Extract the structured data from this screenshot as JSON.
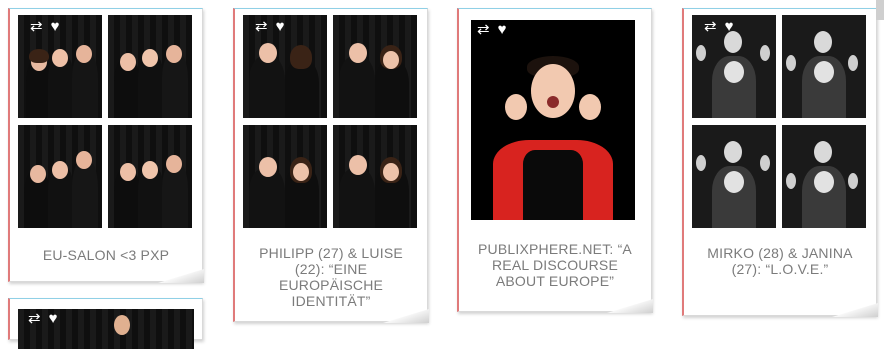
{
  "cards": [
    {
      "caption": "EU-SALON <3 PXP"
    },
    {
      "caption": "PHILIPP (27) & LUISE (22): “EINE EUROPÄISCHE IDENTITÄT”"
    },
    {
      "caption": "PUBLIXPHERE.NET: “A REAL DISCOURSE ABOUT EUROPE”"
    },
    {
      "caption": "MIRKO (28) & JANINA (27): “L.O.V.E.”"
    }
  ],
  "icons": {
    "repost": "repost-icon",
    "like": "heart-icon"
  },
  "colors": {
    "caption": "#7b7b7b",
    "card_top_border": "#8fd0e6",
    "card_left_border": "#e07a7a"
  }
}
